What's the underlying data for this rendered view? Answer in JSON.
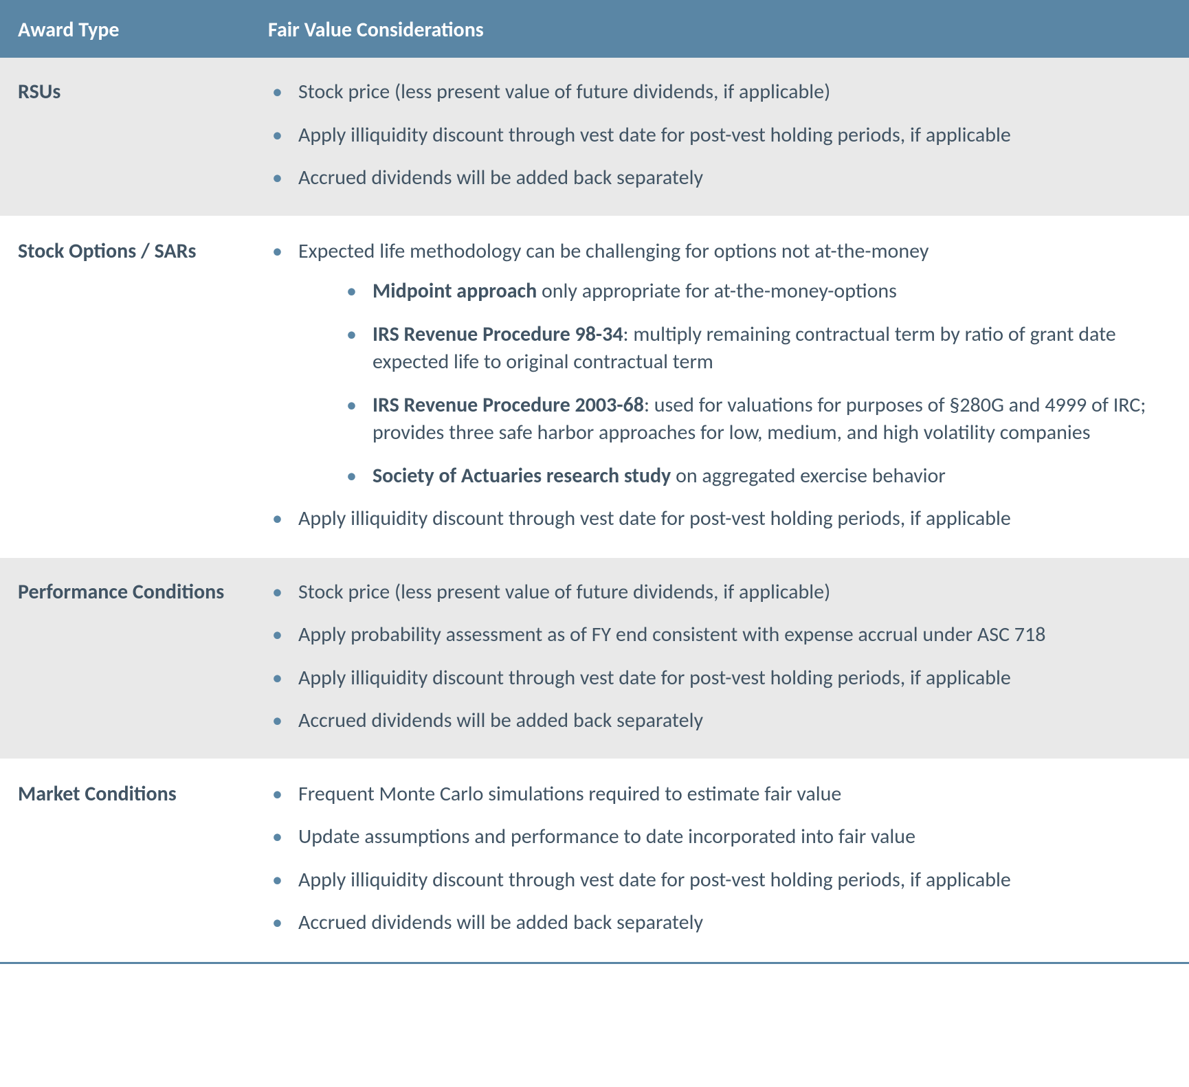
{
  "header": {
    "col1": "Award Type",
    "col2": "Fair Value Considerations"
  },
  "rows": [
    {
      "award_type": "RSUs",
      "alt": true,
      "bullets": [
        {
          "text": "Stock price (less present value of future dividends, if applicable)"
        },
        {
          "text": "Apply illiquidity discount through vest date for post-vest holding periods, if applicable"
        },
        {
          "text": "Accrued dividends will be added back separately"
        }
      ]
    },
    {
      "award_type": "Stock Options / SARs",
      "alt": false,
      "bullets": [
        {
          "text": "Expected life methodology can be challenging for options not at-the-money",
          "sub": [
            {
              "bold": "Midpoint approach",
              "rest": " only appropriate for at-the-money-options"
            },
            {
              "bold": "IRS Revenue Procedure 98-34",
              "rest": ": multiply remaining contractual term by ratio of grant date expected life to original contractual term"
            },
            {
              "bold": "IRS Revenue Procedure 2003-68",
              "rest": ": used for valuations for purposes of §280G and 4999 of IRC; provides three safe harbor approaches for low, medium, and high volatility companies"
            },
            {
              "bold": "Society of Actuaries research study",
              "rest": " on aggregated exercise behavior"
            }
          ]
        },
        {
          "text": "Apply illiquidity discount through vest date for post-vest holding periods, if applicable"
        }
      ]
    },
    {
      "award_type": "Performance Conditions",
      "alt": true,
      "bullets": [
        {
          "text": "Stock price (less present value of future dividends, if applicable)"
        },
        {
          "text": "Apply probability assessment as of FY end consistent with expense accrual under ASC 718"
        },
        {
          "text": "Apply illiquidity discount through vest date for post-vest holding periods, if applicable"
        },
        {
          "text": "Accrued dividends will be added back separately"
        }
      ]
    },
    {
      "award_type": "Market Conditions",
      "alt": false,
      "bullets": [
        {
          "text": "Frequent Monte Carlo simulations required to estimate fair value"
        },
        {
          "text": "Update assumptions and performance to date incorporated into fair value"
        },
        {
          "text": "Apply illiquidity discount through vest date for post-vest holding periods, if applicable"
        },
        {
          "text": "Accrued dividends will be added back separately"
        }
      ]
    }
  ]
}
